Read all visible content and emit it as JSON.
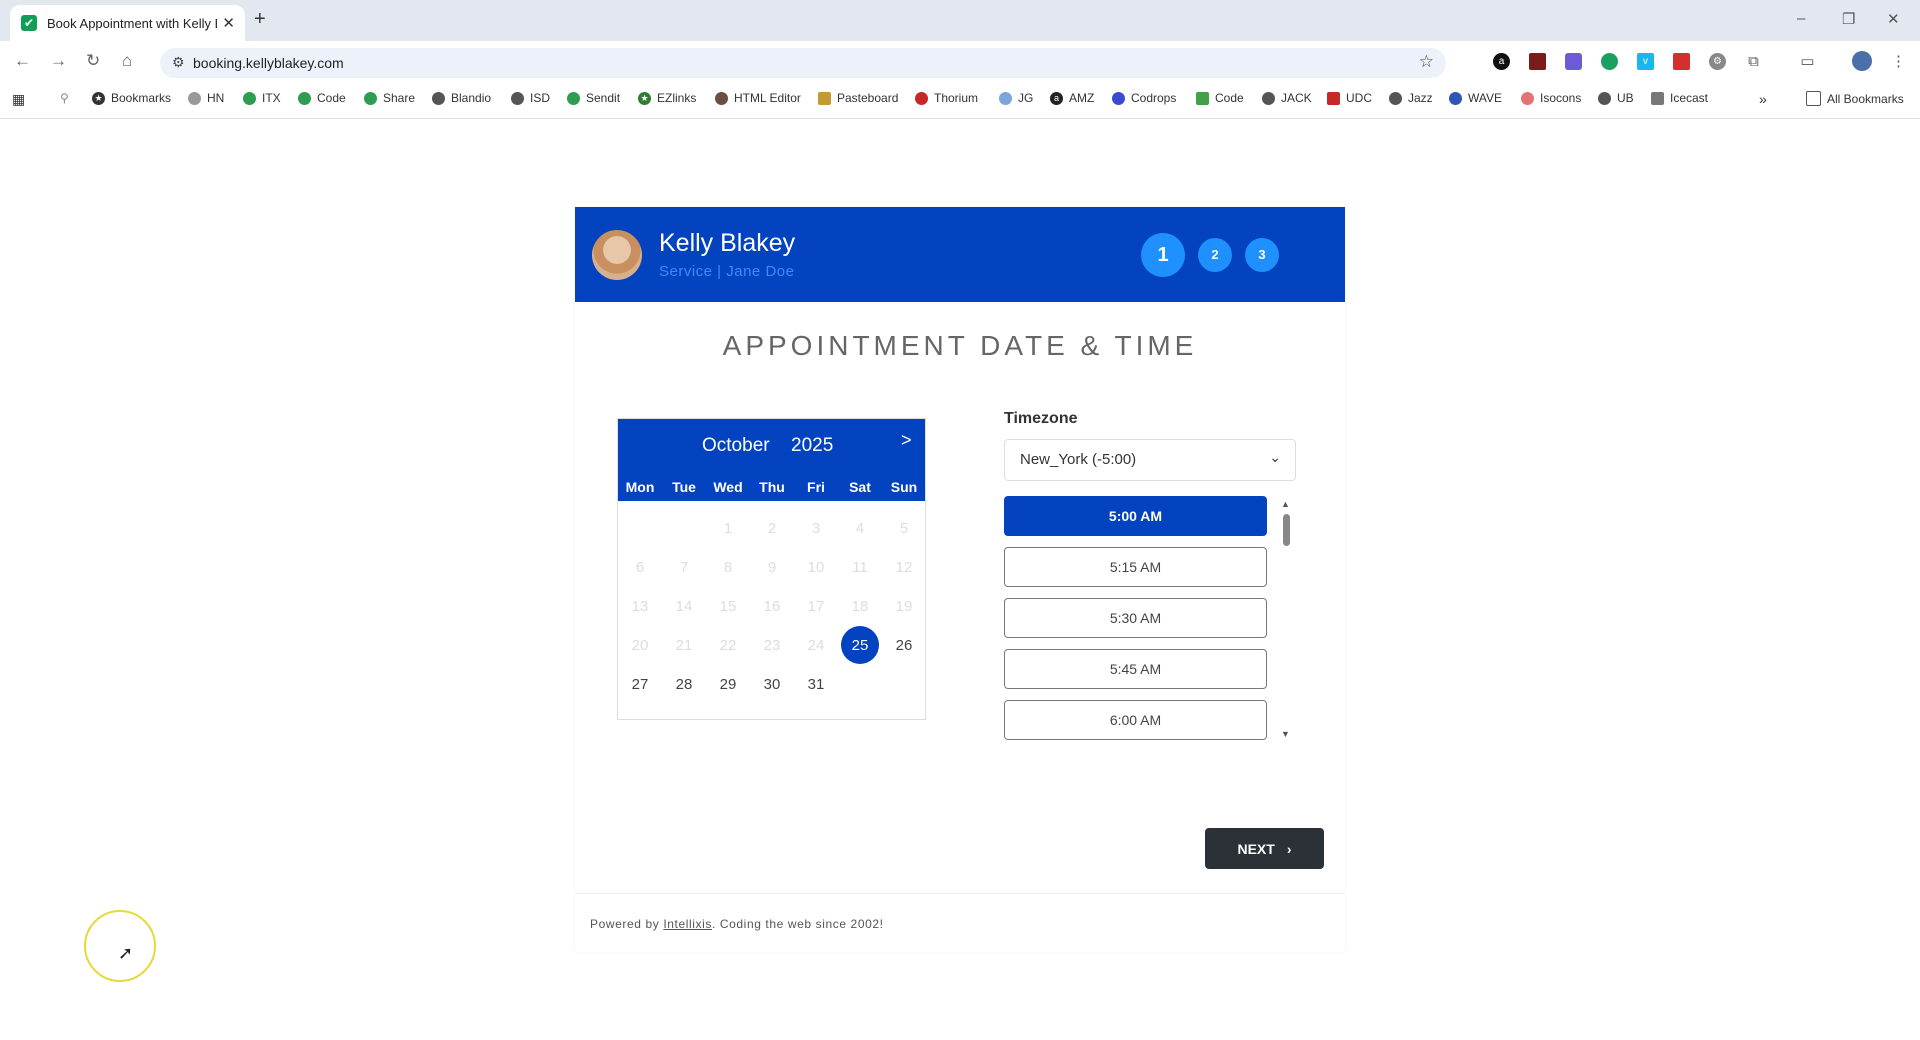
{
  "browser": {
    "tab_title": "Book Appointment with Kelly B",
    "url": "booking.kellyblakey.com",
    "bookmarks": [
      "Bookmarks",
      "HN",
      "ITX",
      "Code",
      "Share",
      "Blandio",
      "ISD",
      "Sendit",
      "EZlinks",
      "HTML Editor",
      "Pasteboard",
      "Thorium",
      "JG",
      "AMZ",
      "Codrops",
      "Code",
      "JACK",
      "UDC",
      "Jazz",
      "WAVE",
      "Isocons",
      "UB",
      "Icecast"
    ],
    "all_bookmarks_label": "All Bookmarks",
    "overflow_label": "»"
  },
  "header": {
    "provider_name": "Kelly Blakey",
    "service_line": "Service  |  Jane Doe",
    "steps": [
      "1",
      "2",
      "3"
    ],
    "active_step": "1",
    "brand_color": "#0443c0"
  },
  "title": "APPOINTMENT DATE & TIME",
  "calendar": {
    "month": "October",
    "year": "2025",
    "next_label": ">",
    "weekdays": [
      "Mon",
      "Tue",
      "Wed",
      "Thu",
      "Fri",
      "Sat",
      "Sun"
    ],
    "weeks": [
      [
        "",
        "",
        "1",
        "2",
        "3",
        "4",
        "5"
      ],
      [
        "6",
        "7",
        "8",
        "9",
        "10",
        "11",
        "12"
      ],
      [
        "13",
        "14",
        "15",
        "16",
        "17",
        "18",
        "19"
      ],
      [
        "20",
        "21",
        "22",
        "23",
        "24",
        "25",
        "26"
      ],
      [
        "27",
        "28",
        "29",
        "30",
        "31",
        "",
        ""
      ]
    ],
    "selected_day": "25",
    "available_days": [
      "26",
      "27",
      "28",
      "29",
      "30",
      "31"
    ]
  },
  "timezone": {
    "label": "Timezone",
    "value": "New_York (-5:00)"
  },
  "slots": [
    "5:00 AM",
    "5:15 AM",
    "5:30 AM",
    "5:45 AM",
    "6:00 AM"
  ],
  "selected_slot": "5:00 AM",
  "next_button": "NEXT",
  "footer": {
    "prefix": "Powered by ",
    "link": "Intellixis",
    "suffix": ". Coding the web since 2002!"
  }
}
